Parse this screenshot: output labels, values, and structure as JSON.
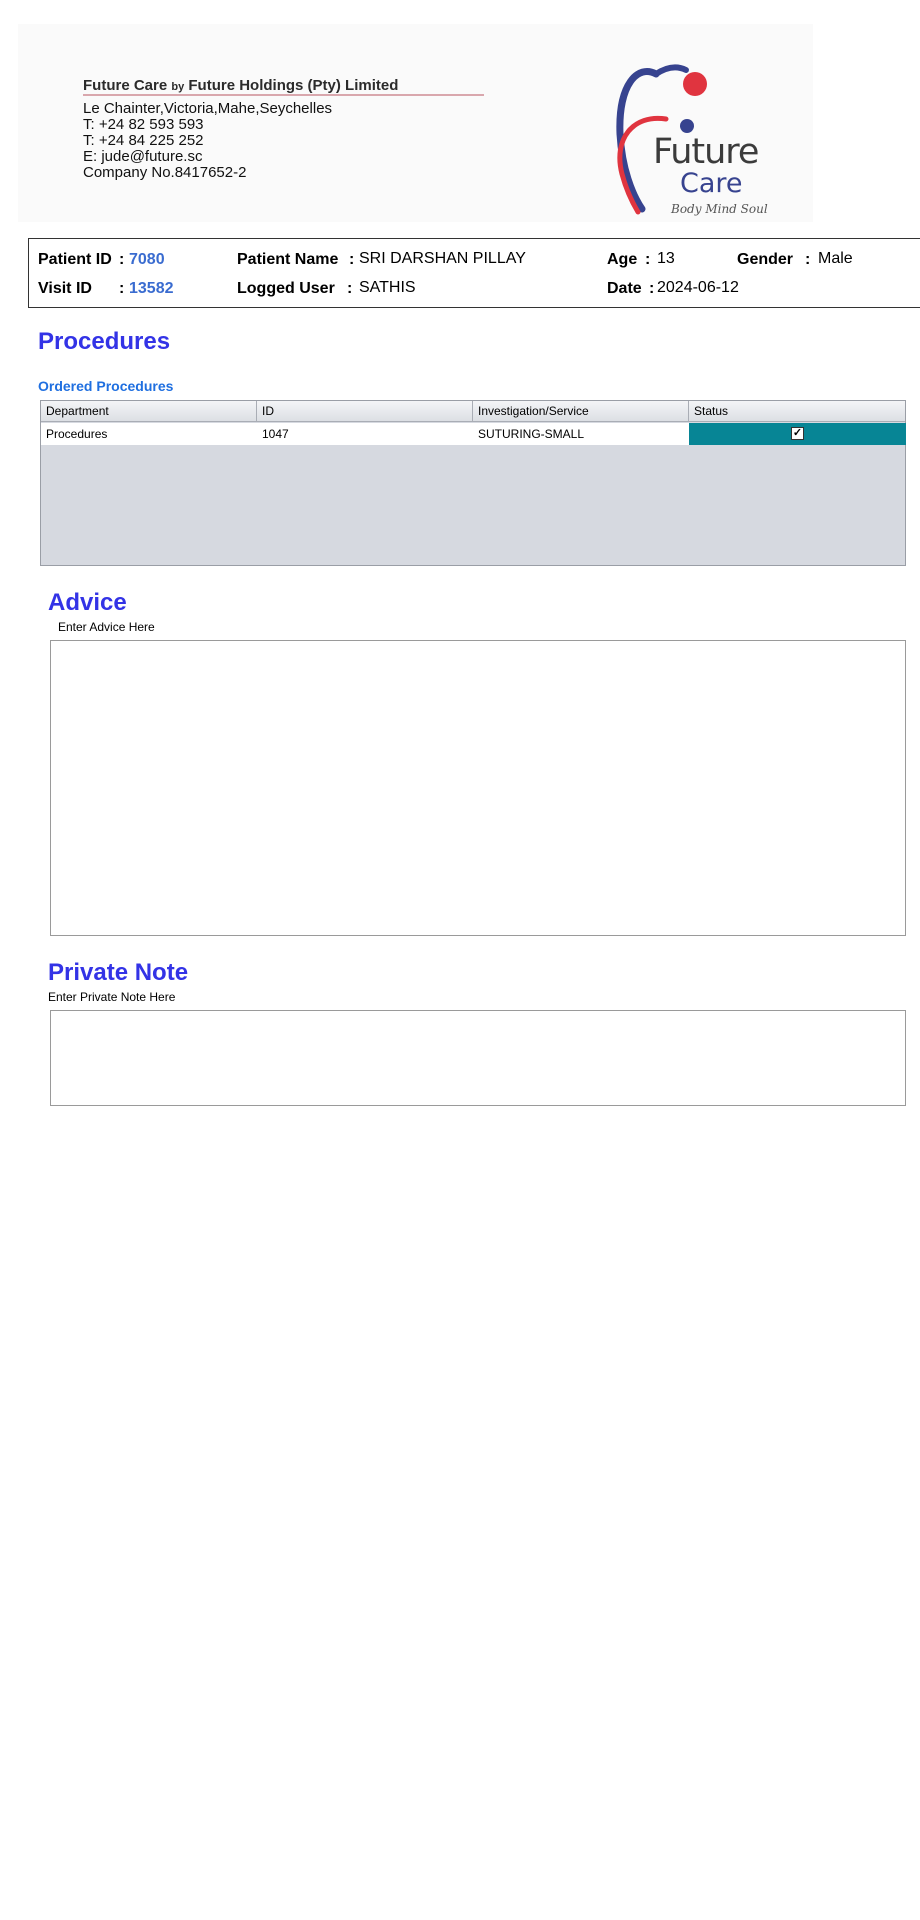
{
  "letterhead": {
    "company_brand": "Future Care",
    "company_by": "by",
    "company_holder": "Future Holdings (Pty) Limited",
    "address": "Le Chainter,Victoria,Mahe,Seychelles",
    "phone1": "T: +24  82 593 593",
    "phone2": "T: +24  84 225 252",
    "email": "E: jude@future.sc",
    "company_no": "Company No.8417652-2",
    "logo": {
      "word1": "Future",
      "word2": "Care",
      "tagline": "Body Mind Soul",
      "icon": "future-care-logo-icon",
      "colors": {
        "blue": "#37438f",
        "red": "#e0343f"
      }
    }
  },
  "patient": {
    "patient_id_label": "Patient ID",
    "patient_id": "7080",
    "visit_id_label": "Visit ID",
    "visit_id": "13582",
    "name_label": "Patient Name",
    "name": "SRI DARSHAN PILLAY",
    "user_label": "Logged User",
    "user": "SATHIS",
    "age_label": "Age",
    "age": "13",
    "gender_label": "Gender",
    "gender": "Male",
    "date_label": "Date",
    "date": "2024-06-12",
    "separator": ":"
  },
  "procedures": {
    "title": "Procedures",
    "subtitle": "Ordered Procedures",
    "columns": [
      "Department",
      "ID",
      "Investigation/Service",
      "Status"
    ],
    "rows": [
      {
        "department": "Procedures",
        "id": "1047",
        "service": "SUTURING-SMALL",
        "status_checked": true,
        "status_mark": "✓"
      }
    ],
    "status_color": "#078595"
  },
  "advice": {
    "title": "Advice",
    "label": "Enter Advice Here",
    "value": ""
  },
  "private_note": {
    "title": "Private Note",
    "label": "Enter Private Note Here",
    "value": ""
  },
  "colors": {
    "section_heading": "#3333e6",
    "subheading": "#1f6fe0",
    "id_value": "#3a6cd0"
  }
}
